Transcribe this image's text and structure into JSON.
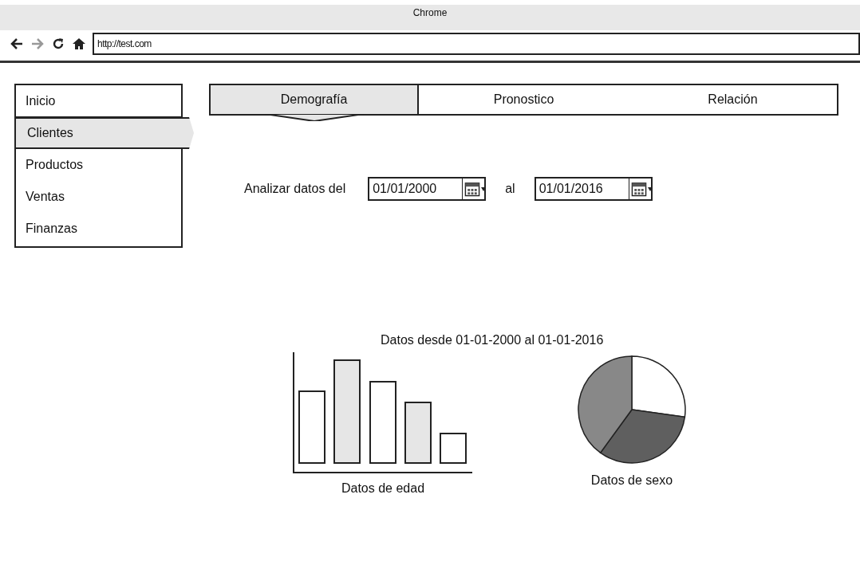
{
  "window": {
    "title": "Chrome"
  },
  "toolbar": {
    "url": "http://test.com"
  },
  "sidebar": {
    "items": [
      {
        "label": "Inicio",
        "selected": false
      },
      {
        "label": "Clientes",
        "selected": true
      },
      {
        "label": "Productos",
        "selected": false
      },
      {
        "label": "Ventas",
        "selected": false
      },
      {
        "label": "Finanzas",
        "selected": false
      }
    ]
  },
  "tabs": [
    {
      "label": "Demografía",
      "selected": true
    },
    {
      "label": "Pronostico",
      "selected": false
    },
    {
      "label": "Relación",
      "selected": false
    }
  ],
  "date_filter": {
    "label": "Analizar datos del",
    "from": {
      "value": "01/01/2000"
    },
    "separator": "al",
    "to": {
      "value": "01/01/2016"
    }
  },
  "charts": {
    "title": "Datos desde 01-01-2000 al 01-01-2016",
    "age_caption": "Datos de edad",
    "sex_caption": "Datos de sexo"
  }
}
